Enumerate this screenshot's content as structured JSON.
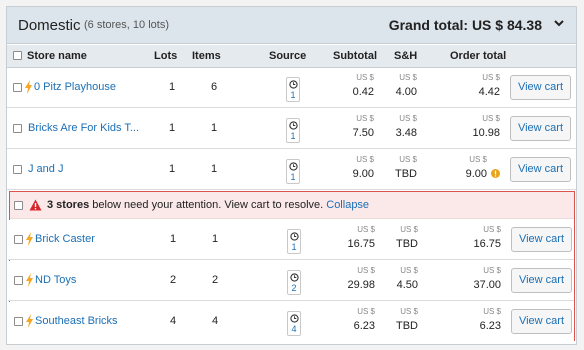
{
  "header": {
    "title": "Domestic",
    "subtitle": "(6 stores, 10 lots)",
    "grand_total": "Grand total: US $ 84.38"
  },
  "columns": {
    "store_name": "Store name",
    "lots": "Lots",
    "items": "Items",
    "source": "Source",
    "subtotal": "Subtotal",
    "sh": "S&H",
    "order_total": "Order total"
  },
  "currency": "US $",
  "view_cart_label": "View cart",
  "stores": [
    {
      "name": "0 Pitz Playhouse",
      "lots": "1",
      "items": "6",
      "source": "1",
      "subtotal": "0.42",
      "sh": "4.00",
      "total": "4.42"
    },
    {
      "name": "Bricks Are For Kids T...",
      "lots": "1",
      "items": "1",
      "source": "1",
      "subtotal": "7.50",
      "sh": "3.48",
      "total": "10.98"
    },
    {
      "name": "J and J",
      "lots": "1",
      "items": "1",
      "source": "1",
      "subtotal": "9.00",
      "sh": "TBD",
      "total": "9.00"
    }
  ],
  "attention": {
    "count_text": "3 stores",
    "message": " below need your attention. View cart to resolve. ",
    "collapse_label": "Collapse"
  },
  "attention_stores": [
    {
      "name": "Brick Caster",
      "lots": "1",
      "items": "1",
      "source": "1",
      "subtotal": "16.75",
      "sh": "TBD",
      "total": "16.75"
    },
    {
      "name": "ND Toys",
      "lots": "2",
      "items": "2",
      "source": "2",
      "subtotal": "29.98",
      "sh": "4.50",
      "total": "37.00"
    },
    {
      "name": "Southeast Bricks",
      "lots": "4",
      "items": "4",
      "source": "4",
      "subtotal": "6.23",
      "sh": "TBD",
      "total": "6.23"
    }
  ],
  "colors": {
    "link": "#1b6fb5",
    "header_bg": "#dde5ec",
    "attention_border": "#d9534f",
    "attention_bg": "#fbe9ea",
    "bolt": "#f5a623",
    "warning": "#e8a317"
  },
  "icons": {
    "bolt": "lightning-bolt-icon",
    "clock": "clock-icon",
    "chevron": "chevron-down-icon",
    "alert": "alert-triangle-icon",
    "info": "info-circle-icon"
  }
}
